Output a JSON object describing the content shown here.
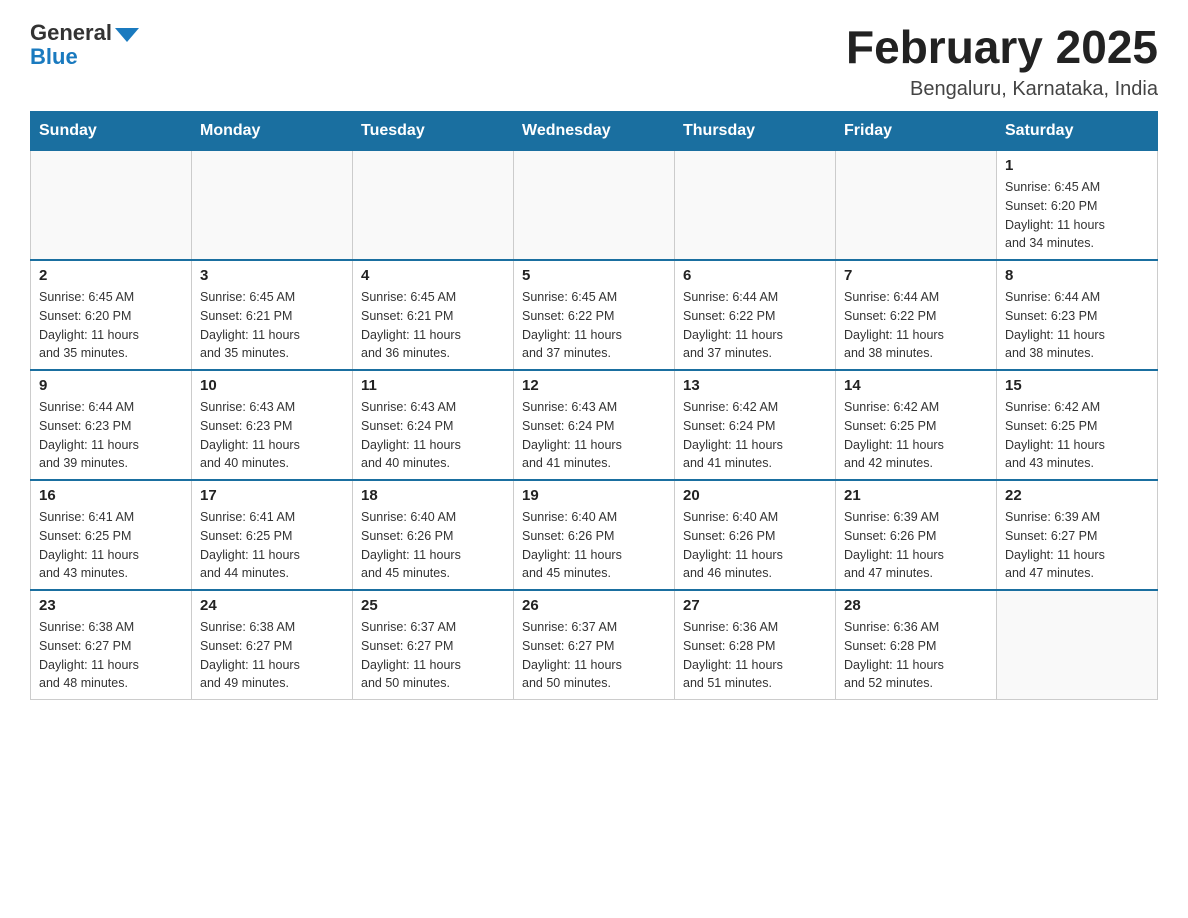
{
  "logo": {
    "general": "General",
    "blue": "Blue"
  },
  "title": "February 2025",
  "location": "Bengaluru, Karnataka, India",
  "headers": [
    "Sunday",
    "Monday",
    "Tuesday",
    "Wednesday",
    "Thursday",
    "Friday",
    "Saturday"
  ],
  "weeks": [
    [
      {
        "day": "",
        "info": ""
      },
      {
        "day": "",
        "info": ""
      },
      {
        "day": "",
        "info": ""
      },
      {
        "day": "",
        "info": ""
      },
      {
        "day": "",
        "info": ""
      },
      {
        "day": "",
        "info": ""
      },
      {
        "day": "1",
        "info": "Sunrise: 6:45 AM\nSunset: 6:20 PM\nDaylight: 11 hours\nand 34 minutes."
      }
    ],
    [
      {
        "day": "2",
        "info": "Sunrise: 6:45 AM\nSunset: 6:20 PM\nDaylight: 11 hours\nand 35 minutes."
      },
      {
        "day": "3",
        "info": "Sunrise: 6:45 AM\nSunset: 6:21 PM\nDaylight: 11 hours\nand 35 minutes."
      },
      {
        "day": "4",
        "info": "Sunrise: 6:45 AM\nSunset: 6:21 PM\nDaylight: 11 hours\nand 36 minutes."
      },
      {
        "day": "5",
        "info": "Sunrise: 6:45 AM\nSunset: 6:22 PM\nDaylight: 11 hours\nand 37 minutes."
      },
      {
        "day": "6",
        "info": "Sunrise: 6:44 AM\nSunset: 6:22 PM\nDaylight: 11 hours\nand 37 minutes."
      },
      {
        "day": "7",
        "info": "Sunrise: 6:44 AM\nSunset: 6:22 PM\nDaylight: 11 hours\nand 38 minutes."
      },
      {
        "day": "8",
        "info": "Sunrise: 6:44 AM\nSunset: 6:23 PM\nDaylight: 11 hours\nand 38 minutes."
      }
    ],
    [
      {
        "day": "9",
        "info": "Sunrise: 6:44 AM\nSunset: 6:23 PM\nDaylight: 11 hours\nand 39 minutes."
      },
      {
        "day": "10",
        "info": "Sunrise: 6:43 AM\nSunset: 6:23 PM\nDaylight: 11 hours\nand 40 minutes."
      },
      {
        "day": "11",
        "info": "Sunrise: 6:43 AM\nSunset: 6:24 PM\nDaylight: 11 hours\nand 40 minutes."
      },
      {
        "day": "12",
        "info": "Sunrise: 6:43 AM\nSunset: 6:24 PM\nDaylight: 11 hours\nand 41 minutes."
      },
      {
        "day": "13",
        "info": "Sunrise: 6:42 AM\nSunset: 6:24 PM\nDaylight: 11 hours\nand 41 minutes."
      },
      {
        "day": "14",
        "info": "Sunrise: 6:42 AM\nSunset: 6:25 PM\nDaylight: 11 hours\nand 42 minutes."
      },
      {
        "day": "15",
        "info": "Sunrise: 6:42 AM\nSunset: 6:25 PM\nDaylight: 11 hours\nand 43 minutes."
      }
    ],
    [
      {
        "day": "16",
        "info": "Sunrise: 6:41 AM\nSunset: 6:25 PM\nDaylight: 11 hours\nand 43 minutes."
      },
      {
        "day": "17",
        "info": "Sunrise: 6:41 AM\nSunset: 6:25 PM\nDaylight: 11 hours\nand 44 minutes."
      },
      {
        "day": "18",
        "info": "Sunrise: 6:40 AM\nSunset: 6:26 PM\nDaylight: 11 hours\nand 45 minutes."
      },
      {
        "day": "19",
        "info": "Sunrise: 6:40 AM\nSunset: 6:26 PM\nDaylight: 11 hours\nand 45 minutes."
      },
      {
        "day": "20",
        "info": "Sunrise: 6:40 AM\nSunset: 6:26 PM\nDaylight: 11 hours\nand 46 minutes."
      },
      {
        "day": "21",
        "info": "Sunrise: 6:39 AM\nSunset: 6:26 PM\nDaylight: 11 hours\nand 47 minutes."
      },
      {
        "day": "22",
        "info": "Sunrise: 6:39 AM\nSunset: 6:27 PM\nDaylight: 11 hours\nand 47 minutes."
      }
    ],
    [
      {
        "day": "23",
        "info": "Sunrise: 6:38 AM\nSunset: 6:27 PM\nDaylight: 11 hours\nand 48 minutes."
      },
      {
        "day": "24",
        "info": "Sunrise: 6:38 AM\nSunset: 6:27 PM\nDaylight: 11 hours\nand 49 minutes."
      },
      {
        "day": "25",
        "info": "Sunrise: 6:37 AM\nSunset: 6:27 PM\nDaylight: 11 hours\nand 50 minutes."
      },
      {
        "day": "26",
        "info": "Sunrise: 6:37 AM\nSunset: 6:27 PM\nDaylight: 11 hours\nand 50 minutes."
      },
      {
        "day": "27",
        "info": "Sunrise: 6:36 AM\nSunset: 6:28 PM\nDaylight: 11 hours\nand 51 minutes."
      },
      {
        "day": "28",
        "info": "Sunrise: 6:36 AM\nSunset: 6:28 PM\nDaylight: 11 hours\nand 52 minutes."
      },
      {
        "day": "",
        "info": ""
      }
    ]
  ]
}
